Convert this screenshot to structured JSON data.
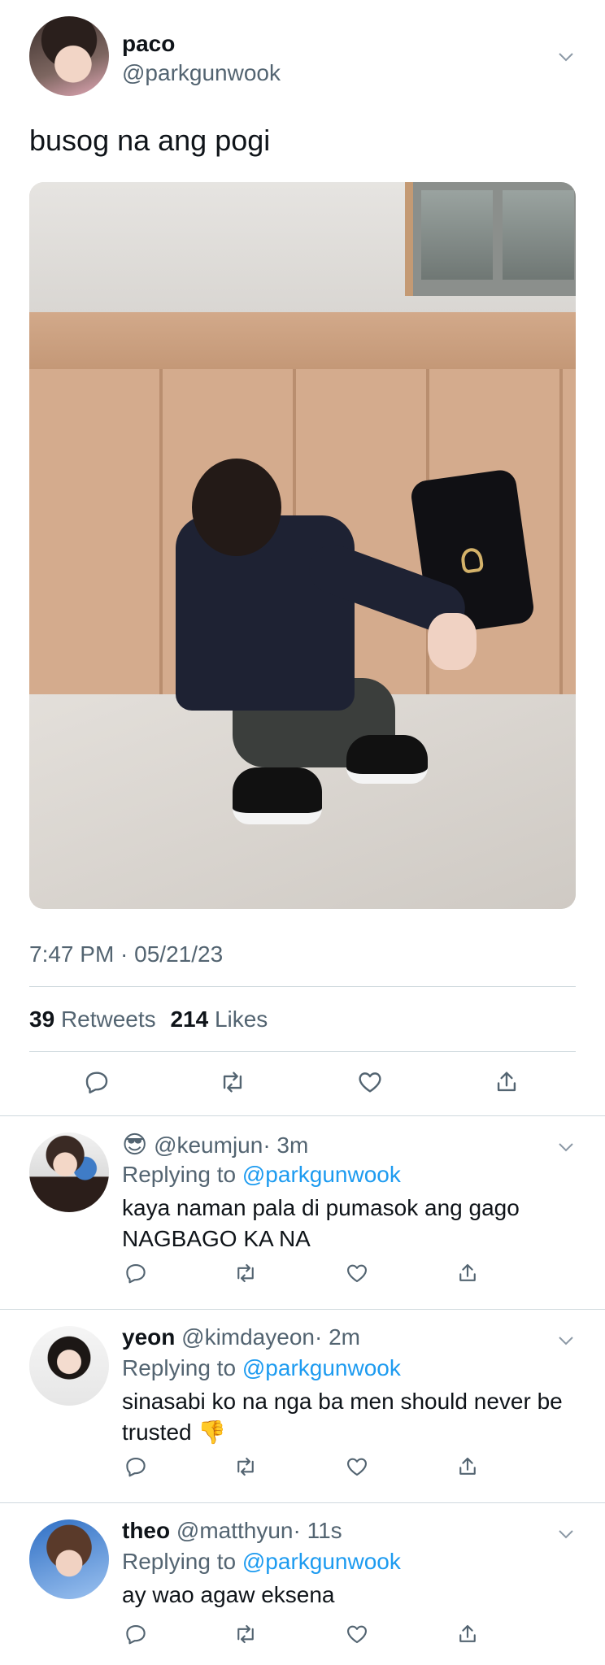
{
  "tweet": {
    "author_name": "paco",
    "author_handle": "@parkgunwook",
    "text": "busog na ang pogi",
    "timestamp": "7:47 PM · 05/21/23",
    "retweets_count": "39",
    "retweets_label": "Retweets",
    "likes_count": "214",
    "likes_label": "Likes"
  },
  "replies": [
    {
      "emoji": "😎",
      "name": "",
      "handle": "@keumjun",
      "time": "· 3m",
      "replying_label": "Replying to",
      "replying_to": "@parkgunwook",
      "text": "kaya naman pala di pumasok ang gago NAGBAGO KA NA"
    },
    {
      "name": "yeon",
      "handle": "@kimdayeon",
      "time": "· 2m",
      "replying_label": "Replying to",
      "replying_to": "@parkgunwook",
      "text": "sinasabi ko na nga ba men should never be trusted 👎"
    },
    {
      "name": "theo",
      "handle": "@matthyun",
      "time": "· 11s",
      "replying_label": "Replying to",
      "replying_to": "@parkgunwook",
      "text": "ay wao agaw eksena"
    }
  ],
  "icons": {
    "reply": "reply-icon",
    "retweet": "retweet-icon",
    "like": "heart-icon",
    "share": "share-icon",
    "more": "chevron-down-icon"
  },
  "colors": {
    "text": "#0f1419",
    "secondary": "#536471",
    "link": "#1d9bf0",
    "divider": "#cfd9de"
  }
}
